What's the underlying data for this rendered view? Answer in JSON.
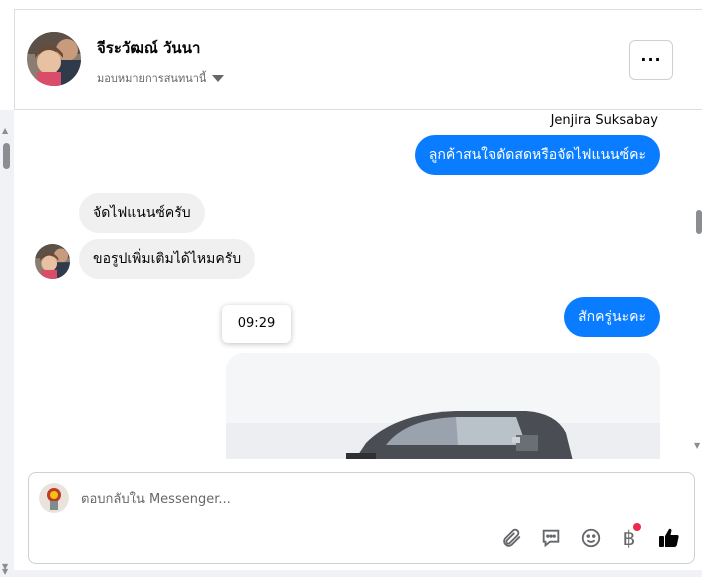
{
  "header": {
    "contact_name": "จีระวัฒณ์ วันนา",
    "assign_label": "มอบหมายการสนทนานี้",
    "more_button_icon": "more-horizontal-icon"
  },
  "conversation": {
    "sender_name": "Jenjira Suksabay",
    "messages": [
      {
        "direction": "outgoing",
        "text": "ลูกค้าสนใจดัดสดหรือจัดไฟแนนซ์คะ"
      },
      {
        "direction": "incoming",
        "text": "จัดไฟแนนซ์ครับ"
      },
      {
        "direction": "incoming",
        "text": "ขอรูปเพิ่มเติมได้ไหมครับ"
      },
      {
        "direction": "outgoing",
        "text": "สักครู่นะคะ"
      }
    ],
    "timestamp_tooltip": "09:29",
    "photo_subject": "gray pickup truck"
  },
  "composer": {
    "placeholder": "ตอบกลับใน Messenger...",
    "tools": [
      "paperclip-icon",
      "chat-bubble-icon",
      "emoji-icon",
      "baht-payment-icon",
      "thumbs-up-icon"
    ],
    "baht_symbol": "฿"
  },
  "colors": {
    "outgoing_bubble": "#0a7cff",
    "incoming_bubble": "#f0f0f0",
    "badge": "#f02849"
  }
}
